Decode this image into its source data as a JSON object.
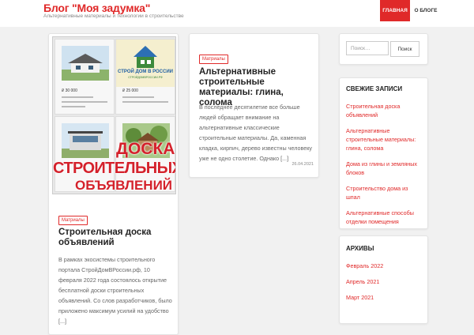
{
  "header": {
    "site_title": "Блог \"Моя задумка\"",
    "site_description": "Альтернативные материалы и технологии в строительстве",
    "nav": [
      {
        "label": "ГЛАВНАЯ",
        "active": true
      },
      {
        "label": "О БЛОГЕ",
        "active": false
      }
    ],
    "accent_color": "#e02929"
  },
  "posts": [
    {
      "category": "Матриалы",
      "title": "Строительная доска объявлений",
      "excerpt": "В рамках экосистемы строительного портала СтройДомВРоссии.рф, 10 февраля 2022 года состоялось открытие бесплатной доски строительных объявлений. Со слов разработчиков, было приложено максимум усилий на удобство [...]",
      "image_overlay_text": [
        "ДОСКА",
        "СТРОИТЕЛЬНЫХ",
        "ОБЪЯВЛЕНИЙ"
      ],
      "logo_text": [
        "СТРОЙ ДОМ В РОССИИ",
        "СТРОЙДОМВРОССИИ.РФ"
      ],
      "prices": [
        "₽ 30 000",
        "₽ 25 000"
      ]
    },
    {
      "category": "Матриалы",
      "title": "Альтернативные строительные материалы: глина, солома",
      "excerpt": "В последнее десятилетие все больше людей обращает внимание на альтернативные классические строительные материалы. Да, каменная кладка, кирпич, дерево известны человеку уже не одно столетие. Однако [...]",
      "date": "26.04.2021"
    }
  ],
  "sidebar": {
    "search": {
      "placeholder": "Поиск…",
      "button": "Поиск"
    },
    "recent": {
      "title": "СВЕЖИЕ ЗАПИСИ",
      "items": [
        "Строительная доска объявлений",
        "Альтернативные строительные материалы: глина, солома",
        "Дома из глины и земляных блоков",
        "Строительство дома из шпал",
        "Альтернативные способы отделки помещения"
      ]
    },
    "archives": {
      "title": "АРХИВЫ",
      "items": [
        "Февраль 2022",
        "Апрель 2021",
        "Март 2021"
      ]
    }
  }
}
